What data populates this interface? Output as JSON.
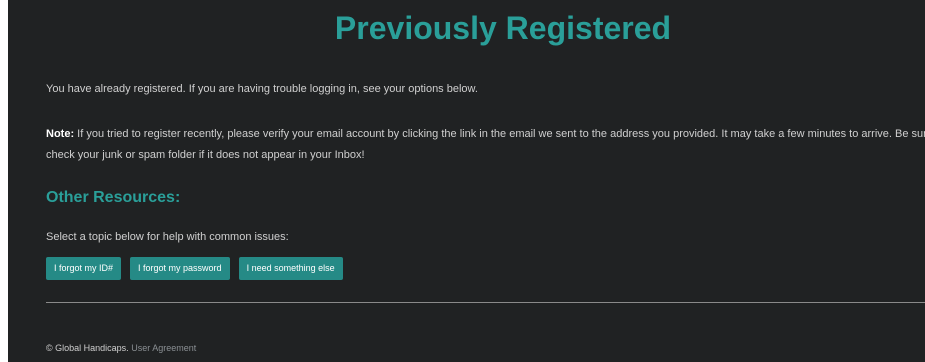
{
  "header": {
    "title": "Previously Registered"
  },
  "main": {
    "intro": "You have already registered. If you are having trouble logging in, see your options below.",
    "note_label": "Note:",
    "note_text": " If you tried to register recently, please verify your email account by clicking the link in the email we sent to the address you provided. It may take a few minutes to arrive. Be sure to check your junk or spam folder if it does not appear in your Inbox!",
    "resources_heading": "Other Resources:",
    "select_prompt": "Select a topic below for help with common issues:",
    "buttons": [
      {
        "label": "I forgot my ID#"
      },
      {
        "label": "I forgot my password"
      },
      {
        "label": "I need something else"
      }
    ]
  },
  "footer": {
    "copyright": "© Global Handicaps.",
    "agreement_link": "User Agreement"
  },
  "colors": {
    "background": "#202223",
    "accent": "#2a9f99",
    "button": "#258a86",
    "text": "#cfcfcf"
  }
}
